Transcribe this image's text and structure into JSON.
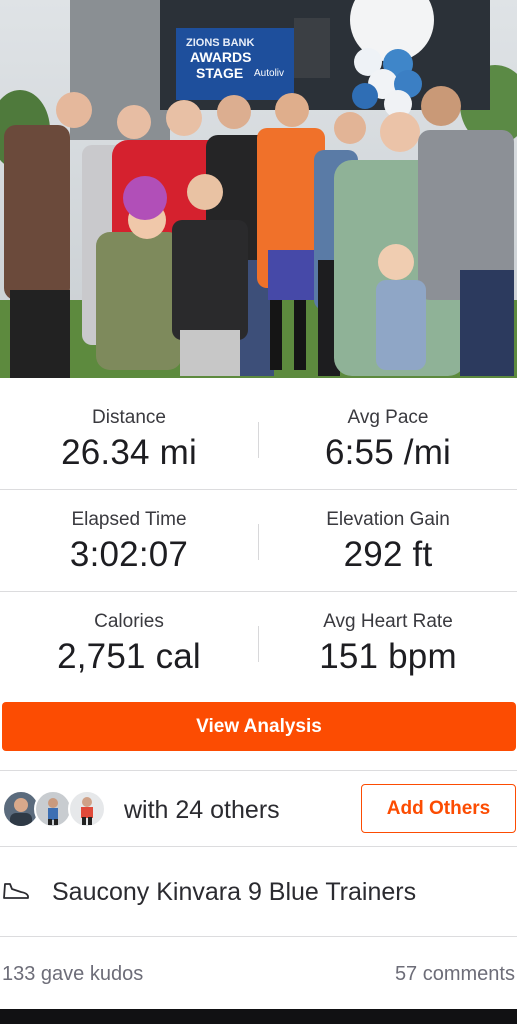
{
  "photo": {
    "alt_subject": "group-photo",
    "banner_text": [
      "ZIONS BANK",
      "AWARDS",
      "STAGE",
      "Autoliv"
    ]
  },
  "stats": [
    {
      "left": {
        "label": "Distance",
        "value": "26.34 mi"
      },
      "right": {
        "label": "Avg Pace",
        "value": "6:55 /mi"
      }
    },
    {
      "left": {
        "label": "Elapsed Time",
        "value": "3:02:07"
      },
      "right": {
        "label": "Elevation Gain",
        "value": "292 ft"
      }
    },
    {
      "left": {
        "label": "Calories",
        "value": "2,751 cal"
      },
      "right": {
        "label": "Avg Heart Rate",
        "value": "151 bpm"
      }
    }
  ],
  "analysis_button": "View Analysis",
  "group": {
    "text": "with 24 others",
    "add_button": "Add Others"
  },
  "gear": {
    "icon": "shoe-icon",
    "name": "Saucony Kinvara 9 Blue Trainers"
  },
  "footer": {
    "kudos": "133 gave kudos",
    "comments": "57 comments"
  },
  "colors": {
    "accent": "#fc4c02",
    "divider": "#dcdcde",
    "muted_text": "#6d6d78"
  }
}
